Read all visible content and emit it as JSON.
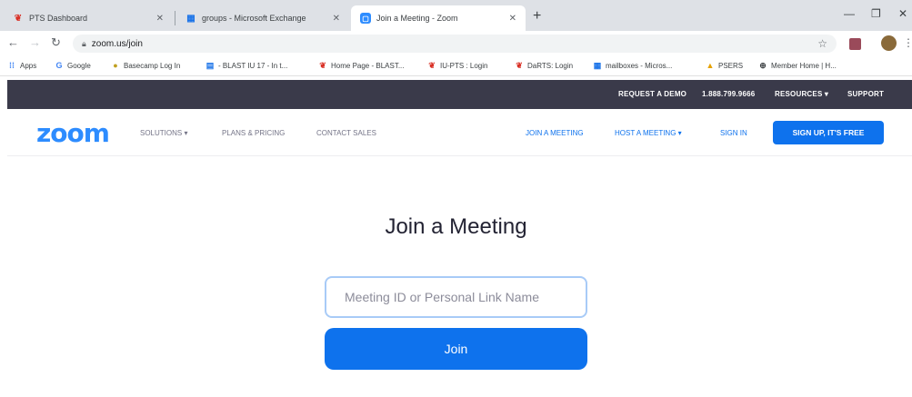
{
  "browser": {
    "tabs": [
      {
        "title": "PTS Dashboard",
        "icon": "red-leaf-favicon",
        "active": false
      },
      {
        "title": "groups - Microsoft Exchange",
        "icon": "exchange-favicon",
        "active": false
      },
      {
        "title": "Join a Meeting - Zoom",
        "icon": "zoom-favicon",
        "active": true
      }
    ],
    "new_tab": "+",
    "url": "zoom.us/join",
    "bookmarks": [
      {
        "label": "Apps",
        "icon": "apps-grid-icon"
      },
      {
        "label": "Google",
        "icon": "google-icon"
      },
      {
        "label": "Basecamp Log In",
        "icon": "basecamp-icon"
      },
      {
        "label": "- BLAST IU 17 - In t...",
        "icon": "page-icon"
      },
      {
        "label": "Home Page - BLAST...",
        "icon": "red-leaf-favicon"
      },
      {
        "label": "IU-PTS : Login",
        "icon": "red-leaf-favicon"
      },
      {
        "label": "DaRTS: Login",
        "icon": "red-leaf-favicon"
      },
      {
        "label": "mailboxes - Micros...",
        "icon": "exchange-favicon"
      },
      {
        "label": "PSERS",
        "icon": "psers-icon"
      },
      {
        "label": "Member Home | H...",
        "icon": "globe-icon"
      }
    ]
  },
  "zoom": {
    "logo": "zoom",
    "top_links": {
      "request_demo": "REQUEST A DEMO",
      "phone": "1.888.799.9666",
      "resources": "RESOURCES ▾",
      "support": "SUPPORT"
    },
    "nav": {
      "solutions": "SOLUTIONS ▾",
      "plans": "PLANS & PRICING",
      "contact": "CONTACT SALES",
      "join": "JOIN A MEETING",
      "host": "HOST A MEETING ▾",
      "sign_in": "SIGN IN",
      "sign_up": "SIGN UP, IT'S FREE"
    },
    "join_page": {
      "title": "Join a Meeting",
      "input_placeholder": "Meeting ID or Personal Link Name",
      "join_button": "Join"
    }
  },
  "colors": {
    "brand_blue": "#0e72ed",
    "logo_blue": "#2d8cff",
    "top_bar": "#3a3a4a"
  }
}
